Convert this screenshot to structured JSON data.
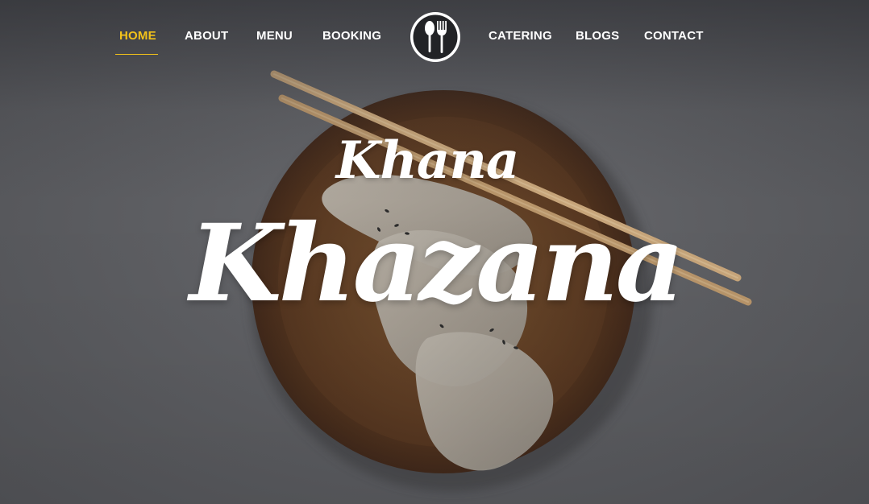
{
  "nav": {
    "items": [
      {
        "label": "HOME",
        "active": true
      },
      {
        "label": "ABOUT"
      },
      {
        "label": "MENU"
      },
      {
        "label": "BOOKING"
      },
      {
        "label": "CATERING"
      },
      {
        "label": "BLOGS"
      },
      {
        "label": "CONTACT"
      }
    ],
    "logo_icon": "spoon-fork-icon"
  },
  "hero": {
    "title_line1": "Khana",
    "title_line2": "Khazana",
    "image": "dumplings-on-wooden-plate-with-chopsticks"
  },
  "colors": {
    "accent": "#f2c21a",
    "text": "#ffffff",
    "background": "#5f6064"
  }
}
